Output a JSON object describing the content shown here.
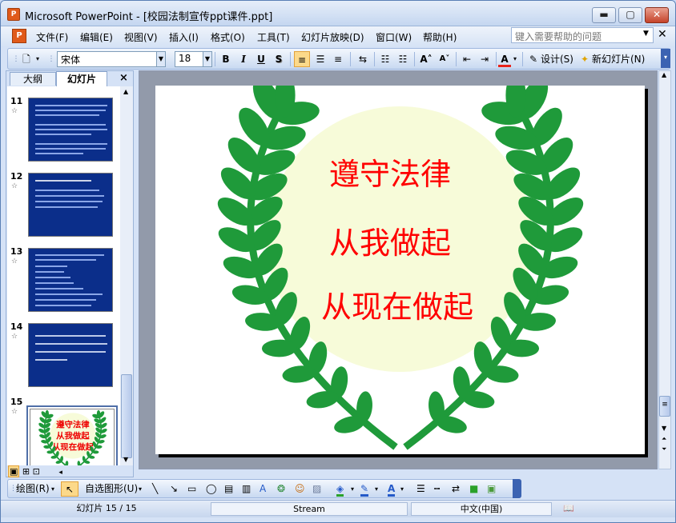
{
  "window": {
    "title": "Microsoft PowerPoint - [校园法制宣传ppt课件.ppt]",
    "minimize": "▬",
    "maximize": "▢",
    "close": "✕"
  },
  "menubar": {
    "items": [
      "文件(F)",
      "编辑(E)",
      "视图(V)",
      "插入(I)",
      "格式(O)",
      "工具(T)",
      "幻灯片放映(D)",
      "窗口(W)",
      "帮助(H)"
    ],
    "help_placeholder": "键入需要帮助的问题"
  },
  "toolbar": {
    "font": "宋体",
    "size": "18",
    "bold": "B",
    "italic": "I",
    "underline": "U",
    "shadow": "S",
    "font_color": "A",
    "design": "设计(S)",
    "new_slide": "新幻灯片(N)"
  },
  "panel": {
    "tab_outline": "大纲",
    "tab_slides": "幻灯片",
    "thumbs": [
      {
        "number": "11"
      },
      {
        "number": "12"
      },
      {
        "number": "13"
      },
      {
        "number": "14"
      },
      {
        "number": "15"
      }
    ]
  },
  "slide": {
    "lines": [
      "遵守法律",
      "从我做起",
      "从现在做起"
    ],
    "text_color": "#ff0000",
    "leaf_color": "#1f9a3a",
    "circle_color": "#f7fbd9"
  },
  "drawbar": {
    "draw": "绘图(R)",
    "autoshapes": "自选图形(U)"
  },
  "status": {
    "slide": "幻灯片 15 / 15",
    "design": "Stream",
    "language": "中文(中国)"
  }
}
